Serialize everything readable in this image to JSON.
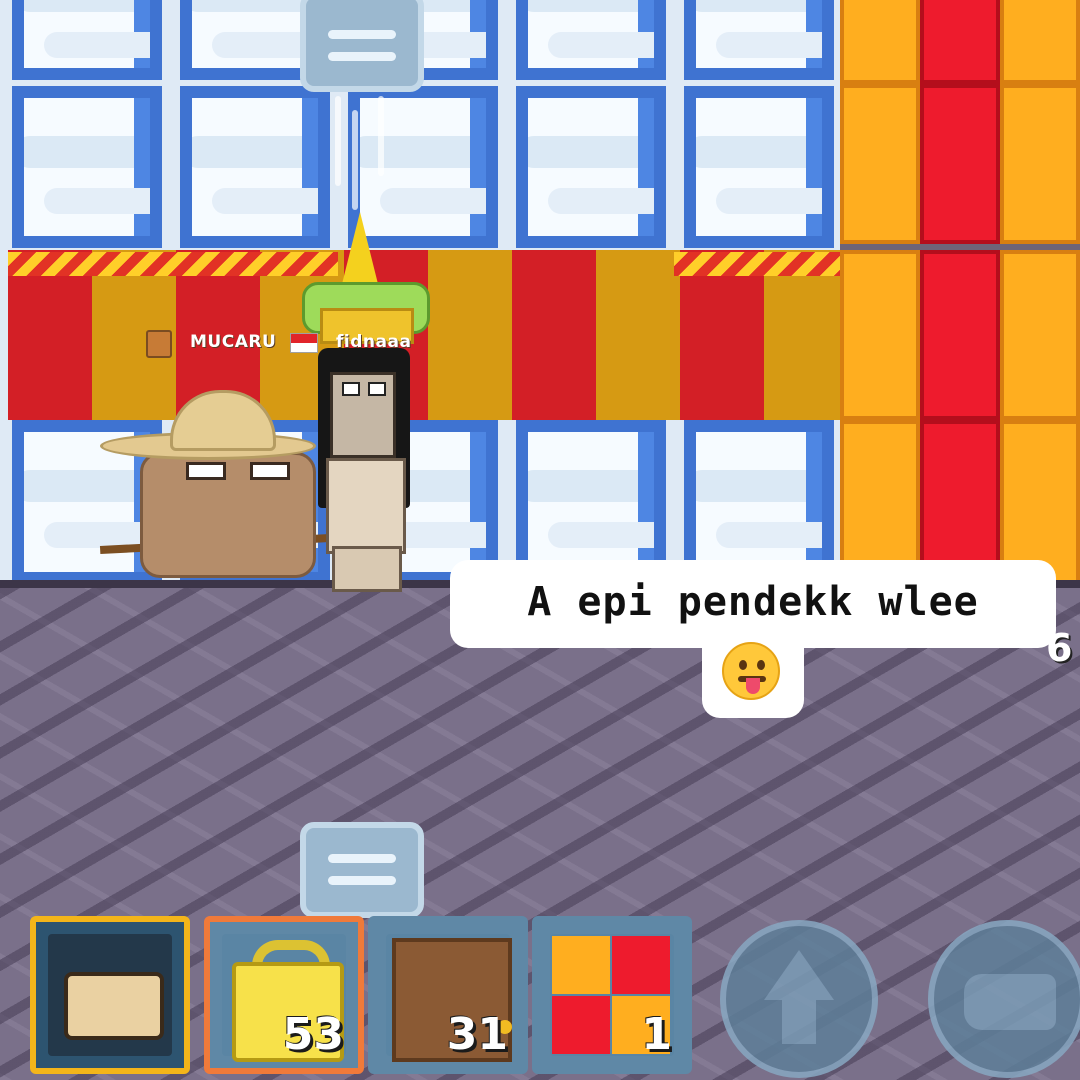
{
  "players": [
    {
      "name": "MUCARU",
      "badge_icon": "trophy-icon"
    },
    {
      "name": "fidnaaa",
      "flag_icon": "indonesia-flag-icon"
    }
  ],
  "chat": {
    "message": "A epi pendekk wlee",
    "emoji_icon": "tongue-out-face-icon",
    "offscreen_text": "6"
  },
  "hotbar": {
    "slots": [
      {
        "item": "fist-icon",
        "count": "",
        "selected": true
      },
      {
        "item": "world-lock-icon",
        "count": "53"
      },
      {
        "item": "wooden-door-icon",
        "count": "31"
      },
      {
        "item": "gift-block-icon",
        "count": "1"
      }
    ]
  },
  "controls": {
    "jump_icon": "jump-arrow-icon",
    "punch_icon": "punch-icon"
  },
  "colors": {
    "window_frame": "#3f73d1",
    "stripe_red": "#d31f26",
    "stripe_gold": "#d69a13",
    "selected_slot": "#f3b51a",
    "lock_slot": "#f07a3a"
  }
}
